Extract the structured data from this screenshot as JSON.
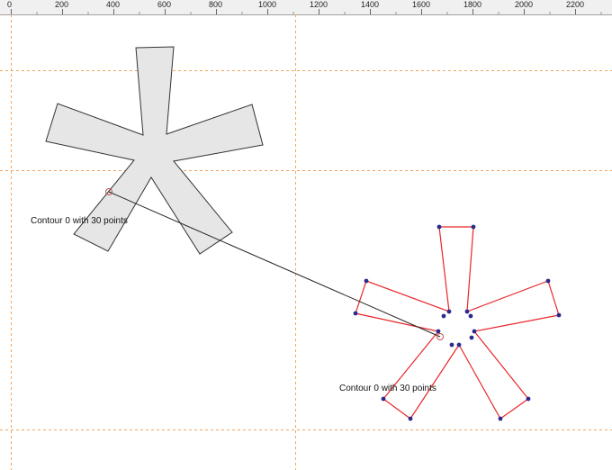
{
  "ruler": {
    "ticks": [
      "0",
      "200",
      "400",
      "600",
      "800",
      "1000",
      "1200",
      "1400",
      "1600",
      "1800",
      "2000",
      "2200"
    ]
  },
  "glyph": {
    "contour_label": "Contour 0 with 30 points",
    "fill_color": "#e6e6e6",
    "outline_color": "#333333"
  },
  "interpolated": {
    "contour_label": "Contour 0 with 30 points",
    "line_color": "#e8262b",
    "point_color": "#2b2b8c"
  },
  "guides": {
    "color": "#f4a460"
  }
}
